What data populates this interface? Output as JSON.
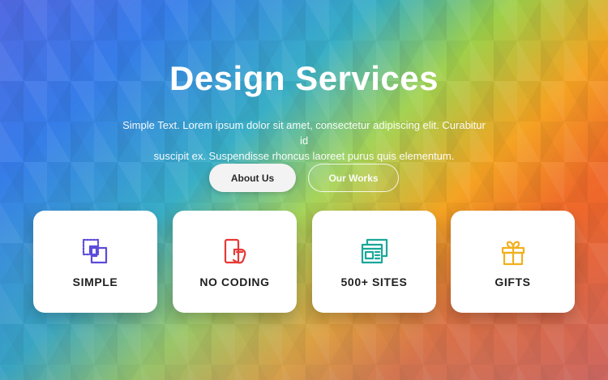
{
  "hero": {
    "title": "Design Services",
    "subtitle_line1": "Simple Text. Lorem ipsum dolor sit amet, consectetur adipiscing elit. Curabitur id",
    "subtitle_line2": "suscipit ex. Suspendisse rhoncus laoreet purus quis elementum."
  },
  "buttons": {
    "primary": "About Us",
    "secondary": "Our Works"
  },
  "features": [
    {
      "label": "SIMPLE",
      "icon": "select-shape-icon",
      "color": "#5b4bdb"
    },
    {
      "label": "NO CODING",
      "icon": "touch-device-icon",
      "color": "#e53935"
    },
    {
      "label": "500+ SITES",
      "icon": "website-layouts-icon",
      "color": "#1aa79a"
    },
    {
      "label": "GIFTS",
      "icon": "gift-icon",
      "color": "#f2b01e"
    }
  ]
}
